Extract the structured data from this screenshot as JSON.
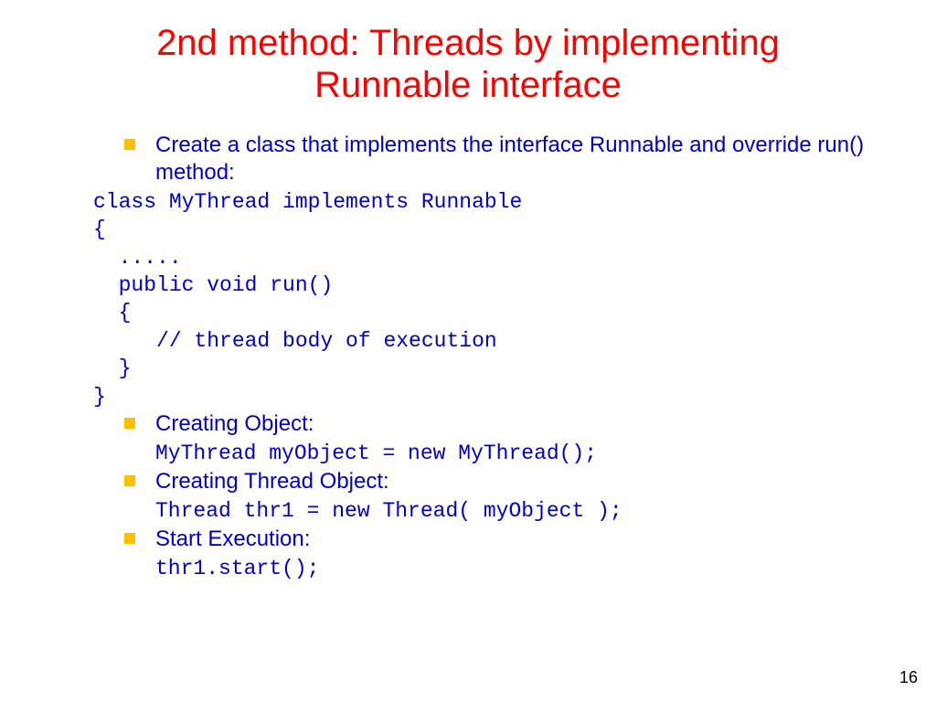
{
  "title": "2nd method: Threads by implementing Runnable interface",
  "bullets": {
    "b1": "Create a class that implements the interface Runnable and override run() method:",
    "b2": "Creating Object:",
    "b3": "Creating Thread Object:",
    "b4": "Start Execution:"
  },
  "code": {
    "classdecl": "class MyThread implements Runnable\n{\n  .....\n  public void run()\n  {\n     // thread body of execution\n  }\n}",
    "createobj": "MyThread myObject = new MyThread();",
    "createthread": "Thread thr1 = new Thread( myObject );",
    "startexec": "thr1.start();"
  },
  "pageNumber": "16"
}
